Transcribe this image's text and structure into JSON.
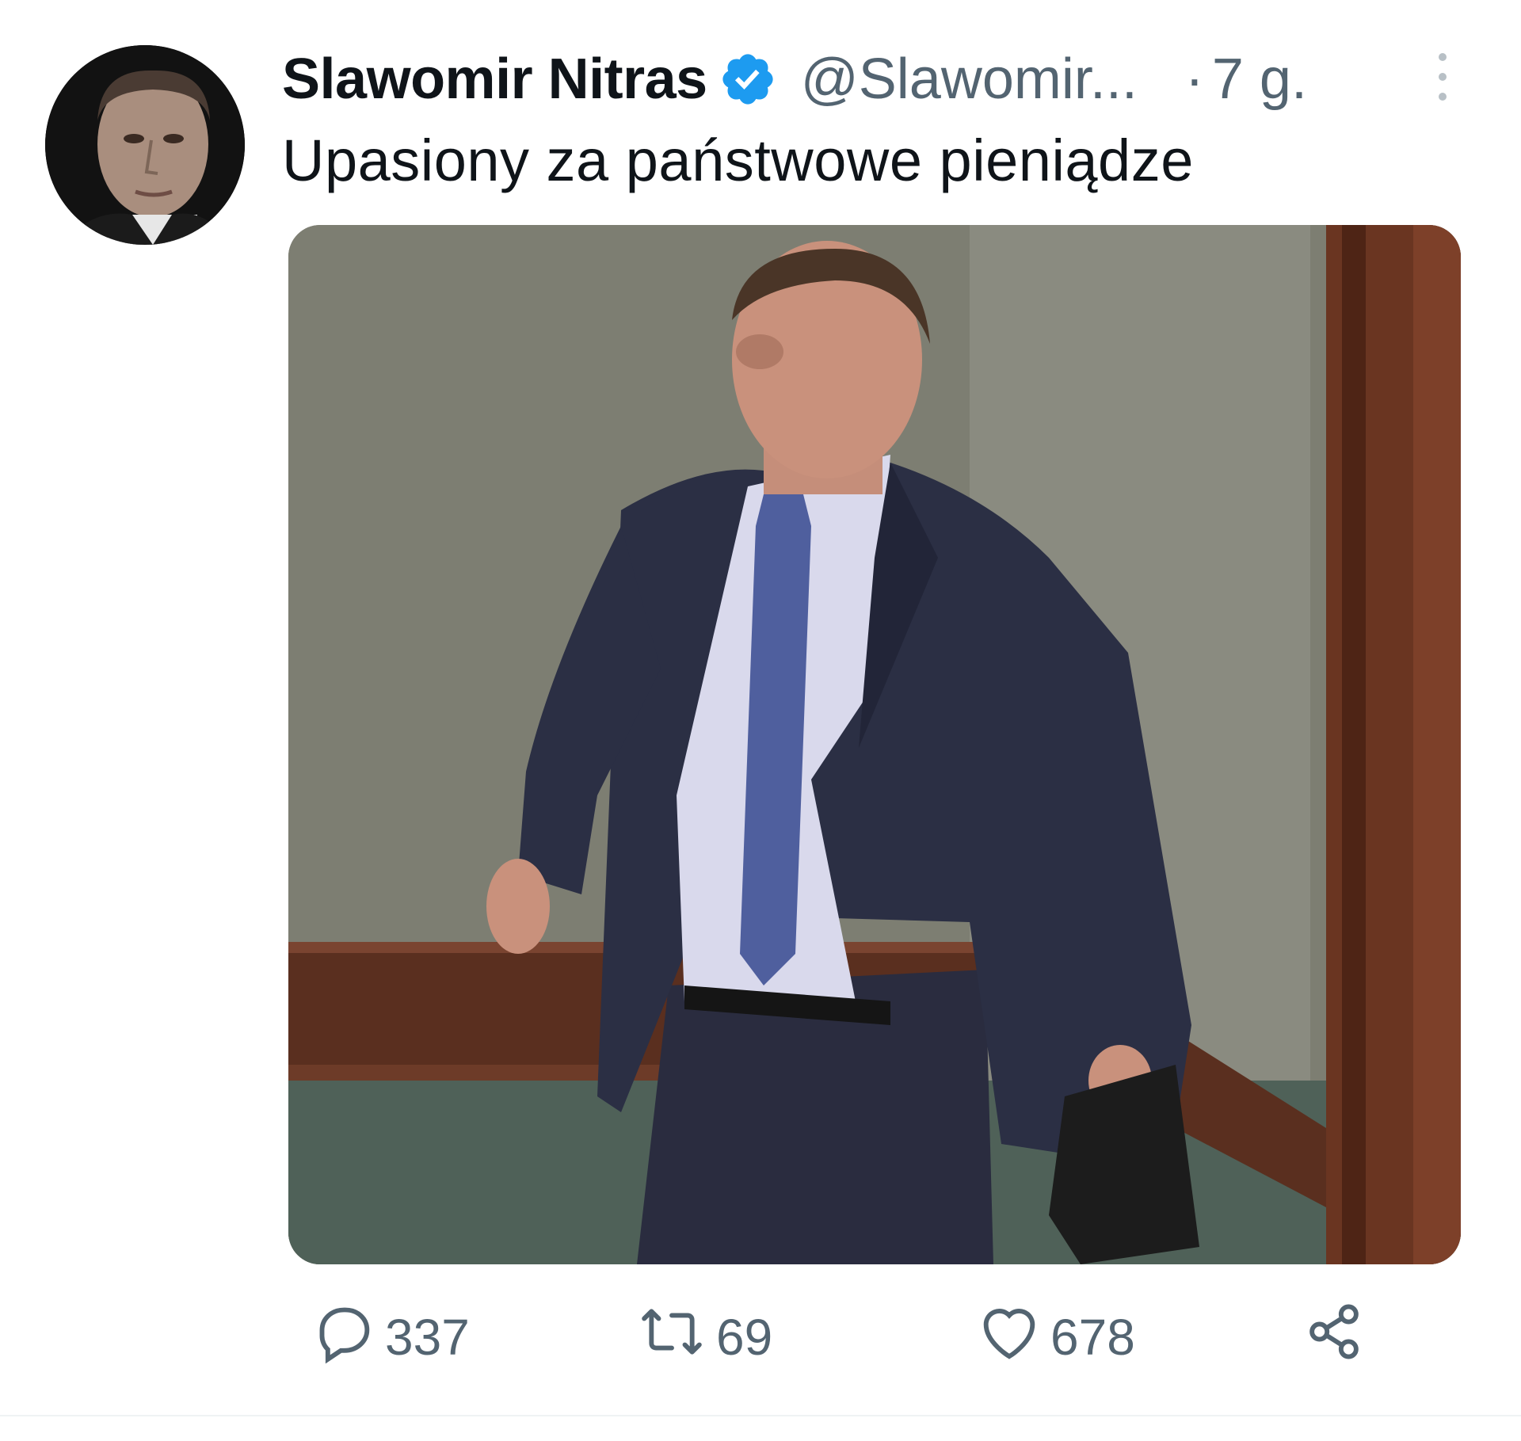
{
  "tweet": {
    "author": {
      "display_name": "Slawomir Nitras",
      "handle": "@Slawomir...",
      "verified": true,
      "avatar_icon": "profile-photo"
    },
    "separator": "·",
    "timestamp": "7 g.",
    "text": "Upasiony za państwowe pieniądze",
    "media": {
      "type": "photo"
    },
    "actions": {
      "reply_count": "337",
      "retweet_count": "69",
      "like_count": "678",
      "reply_icon": "reply-icon",
      "retweet_icon": "retweet-icon",
      "like_icon": "heart-icon",
      "share_icon": "share-icon"
    }
  },
  "colors": {
    "text_primary": "#0f1419",
    "text_secondary": "#536471",
    "verified_blue": "#1d9bf0",
    "divider": "#eff3f4"
  }
}
